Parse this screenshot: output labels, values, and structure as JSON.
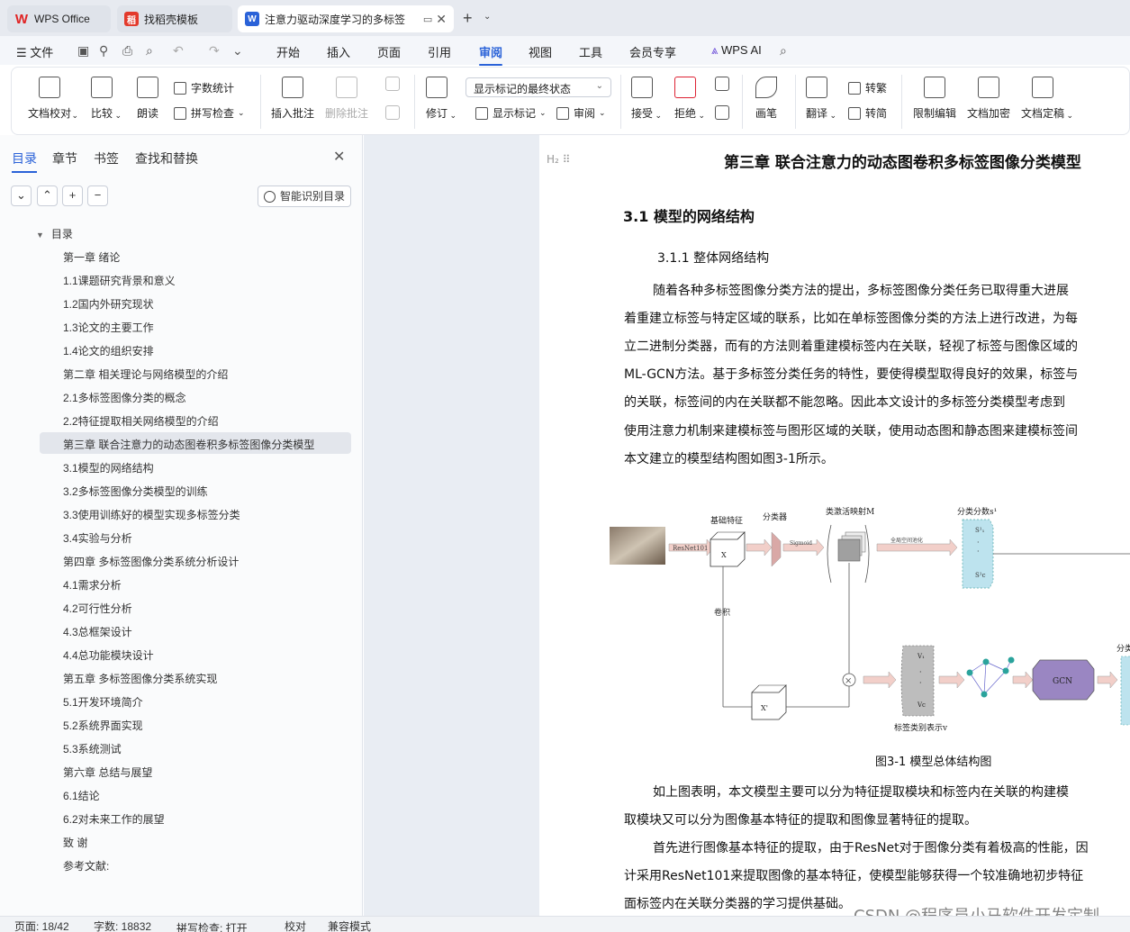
{
  "tabs": [
    {
      "label": "WPS Office"
    },
    {
      "label": "找稻壳模板"
    },
    {
      "label": "注意力驱动深度学习的多标签"
    }
  ],
  "menu": {
    "file": "文件",
    "items": [
      "开始",
      "插入",
      "页面",
      "引用",
      "审阅",
      "视图",
      "工具",
      "会员专享"
    ],
    "active": "审阅",
    "ai": "WPS AI"
  },
  "ribbon": {
    "doc_proof": "文档校对",
    "compare": "比较",
    "read_aloud": "朗读",
    "word_count": "字数统计",
    "spell_check": "拼写检查",
    "insert_comment": "插入批注",
    "delete_comment": "删除批注",
    "track": "修订",
    "markup_state": "显示标记的最终状态",
    "show_markup": "显示标记",
    "review": "审阅",
    "accept": "接受",
    "reject": "拒绝",
    "pen": "画笔",
    "translate": "翻译",
    "to_trad": "转繁",
    "to_simp": "转简",
    "restrict": "限制编辑",
    "encrypt": "文档加密",
    "finalize": "文档定稿"
  },
  "left_panel": {
    "tabs": [
      "目录",
      "章节",
      "书签",
      "查找和替换"
    ],
    "smart_toc": "智能识别目录",
    "toc_root": "目录",
    "toc": [
      "第一章 绪论",
      "1.1课题研究背景和意义",
      "1.2国内外研究现状",
      "1.3论文的主要工作",
      "1.4论文的组织安排",
      "第二章 相关理论与网络模型的介绍",
      "2.1多标签图像分类的概念",
      "2.2特征提取相关网络模型的介绍",
      "第三章 联合注意力的动态图卷积多标签图像分类模型",
      "3.1模型的网络结构",
      "3.2多标签图像分类模型的训练",
      "3.3使用训练好的模型实现多标签分类",
      "3.4实验与分析",
      "第四章 多标签图像分类系统分析设计",
      "4.1需求分析",
      "4.2可行性分析",
      "4.3总框架设计",
      "4.4总功能模块设计",
      "第五章 多标签图像分类系统实现",
      "5.1开发环境简介",
      "5.2系统界面实现",
      "5.3系统测试",
      "第六章 总结与展望",
      "6.1结论",
      "6.2对未来工作的展望",
      "致 谢",
      "参考文献:"
    ],
    "active_index": 8
  },
  "document": {
    "heading_marker": "H₂",
    "chapter_title": "第三章 联合注意力的动态图卷积多标签图像分类模型",
    "section_title": "3.1  模型的网络结构",
    "subsection_title": "3.1.1      整体网络结构",
    "paragraphs": [
      "随着各种多标签图像分类方法的提出，多标签图像分类任务已取得重大进展",
      "着重建立标签与特定区域的联系，比如在单标签图像分类的方法上进行改进，为每",
      "立二进制分类器，而有的方法则着重建模标签内在关联，轻视了标签与图像区域的",
      "ML-GCN方法。基于多标签分类任务的特性，要使得模型取得良好的效果，标签与",
      "的关联，标签间的内在关联都不能忽略。因此本文设计的多标签分类模型考虑到",
      "使用注意力机制来建模标签与图形区域的关联，使用动态图和静态图来建模标签间",
      "本文建立的模型结构图如图3-1所示。"
    ],
    "figure": {
      "labels": {
        "base_feature": "基础特征",
        "classifier": "分类器",
        "cam": "类激活映射M",
        "score": "分类分数s¹",
        "resnet": "ResNet101",
        "sigmoid": "Sigmoid",
        "gap": "全局空间池化",
        "x": "X",
        "x2": "X'",
        "conv": "卷积",
        "s1": "S¹₁",
        "sc": "S¹c",
        "v1": "V₁",
        "vc": "Vc",
        "label_repr": "标签类别表示v",
        "gcn": "GCN",
        "score2": "分类"
      }
    },
    "caption": "图3-1 模型总体结构图",
    "paragraphs2": [
      "如上图表明，本文模型主要可以分为特征提取模块和标签内在关联的构建模",
      "取模块又可以分为图像基本特征的提取和图像显著特征的提取。",
      "首先进行图像基本特征的提取，由于ResNet对于图像分类有着极高的性能，因",
      "计采用ResNet101来提取图像的基本特征，使模型能够获得一个较准确地初步特征",
      "面标签内在关联分类器的学习提供基础。"
    ]
  },
  "status": {
    "page": "页面: 18/42",
    "words": "字数: 18832",
    "spell": "拼写检查: 打开",
    "proof": "校对",
    "compat": "兼容模式"
  },
  "watermark": "CSDN @程序员小马软件开发定制",
  "colors": {
    "accent": "#2a62d8",
    "toc_highlight": "#e3e6ec"
  }
}
